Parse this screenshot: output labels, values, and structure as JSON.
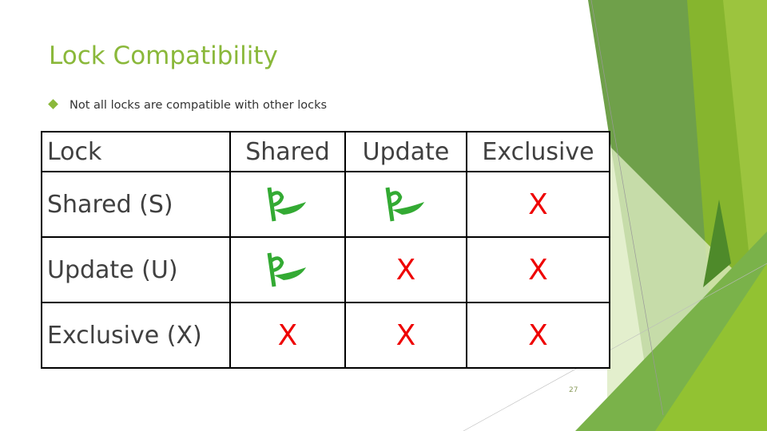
{
  "slide": {
    "title": "Lock Compatibility",
    "bullets": [
      "Not all locks are compatible with other locks"
    ],
    "page_number": "27",
    "accent_color": "#8ab83a"
  },
  "table": {
    "headers": [
      "Lock",
      "Shared",
      "Update",
      "Exclusive"
    ],
    "rows": [
      {
        "label": "Shared (S)",
        "cells": [
          {
            "compatible": true,
            "icon": "flag-icon"
          },
          {
            "compatible": true,
            "icon": "flag-icon"
          },
          {
            "compatible": false,
            "text": "X"
          }
        ]
      },
      {
        "label": "Update (U)",
        "cells": [
          {
            "compatible": true,
            "icon": "flag-icon"
          },
          {
            "compatible": false,
            "text": "X"
          },
          {
            "compatible": false,
            "text": "X"
          }
        ]
      },
      {
        "label": "Exclusive (X)",
        "cells": [
          {
            "compatible": false,
            "text": "X"
          },
          {
            "compatible": false,
            "text": "X"
          },
          {
            "compatible": false,
            "text": "X"
          }
        ]
      }
    ],
    "compatible_color": "#33aa33",
    "incompatible_color": "#ee0000"
  }
}
